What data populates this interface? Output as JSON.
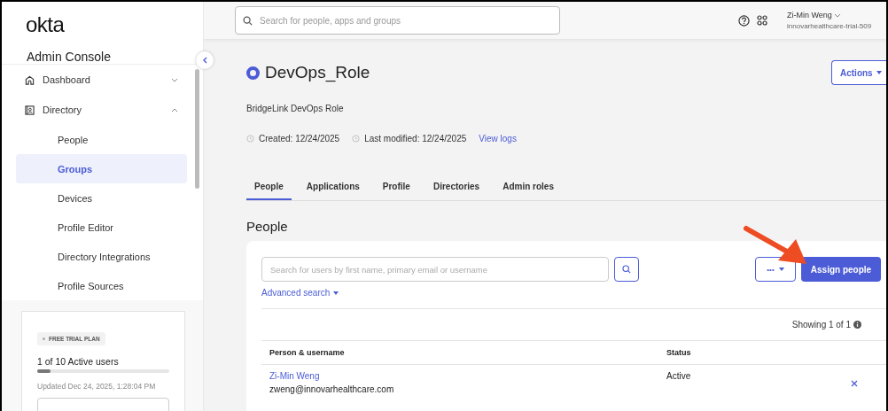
{
  "sidebar": {
    "logo": "okta",
    "title": "Admin Console",
    "nav": [
      {
        "label": "Dashboard",
        "expanded": false
      },
      {
        "label": "Directory",
        "expanded": true,
        "children": [
          {
            "label": "People",
            "selected": false
          },
          {
            "label": "Groups",
            "selected": true
          },
          {
            "label": "Devices",
            "selected": false
          },
          {
            "label": "Profile Editor",
            "selected": false
          },
          {
            "label": "Directory Integrations",
            "selected": false
          },
          {
            "label": "Profile Sources",
            "selected": false
          }
        ]
      }
    ],
    "trial": {
      "badge": "FREE TRIAL PLAN",
      "users": "1 of 10 Active users",
      "level": 0.1,
      "updated": "Updated Dec 24, 2025, 1:28:04 PM"
    }
  },
  "topbar": {
    "search": {
      "placeholder": "Search for people, apps and groups"
    },
    "user": {
      "name": "Zi-Min Weng",
      "org": "innovarhealthcare-trial-509"
    }
  },
  "group": {
    "title": "DevOps_Role",
    "description": "BridgeLink DevOps Role",
    "created": "Created: 12/24/2025",
    "modified": "Last modified: 12/24/2025",
    "logs_link": "View logs",
    "actions": "Actions"
  },
  "tabs": [
    {
      "label": "People",
      "selected": true
    },
    {
      "label": "Applications",
      "selected": false
    },
    {
      "label": "Profile",
      "selected": false
    },
    {
      "label": "Directories",
      "selected": false
    },
    {
      "label": "Admin roles",
      "selected": false
    }
  ],
  "people": {
    "heading": "People",
    "search": {
      "placeholder": "Search for users by first name, primary email or username"
    },
    "more_button": "•••",
    "assign_button": "Assign people",
    "advanced_search": "Advanced search",
    "showing": "Showing 1 of 1",
    "columns": [
      "Person & username",
      "Status"
    ],
    "rows": [
      {
        "name": "Zi-Min Weng",
        "username": "zweng@innovarhealthcare.com",
        "status": "Active"
      }
    ]
  }
}
